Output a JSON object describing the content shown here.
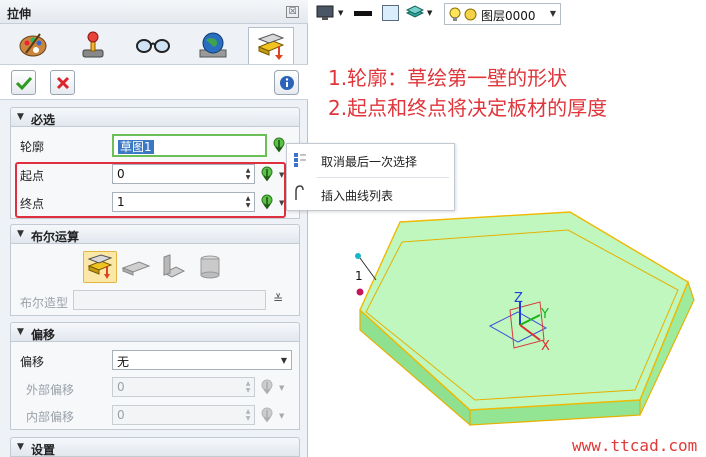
{
  "panel": {
    "title": "拉伸",
    "pin_glyph": "☒",
    "tabs": [
      {
        "name": "palette-icon"
      },
      {
        "name": "joystick-icon"
      },
      {
        "name": "glasses-icon"
      },
      {
        "name": "globe-icon"
      },
      {
        "name": "extrude-icon"
      }
    ],
    "actions": {
      "ok_icon": "checkmark-icon",
      "cancel_icon": "cross-icon",
      "info_icon": "info-icon"
    },
    "required": {
      "header": "必选",
      "profile_label": "轮廓",
      "profile_value": "草图1",
      "start_label": "起点",
      "start_value": "0",
      "end_label": "终点",
      "end_value": "1"
    },
    "boolean": {
      "header": "布尔运算",
      "shape_label": "布尔造型",
      "shape_value": ""
    },
    "offset": {
      "header": "偏移",
      "offset_label": "偏移",
      "offset_value": "无",
      "outer_label": "外部偏移",
      "outer_value": "0",
      "inner_label": "内部偏移",
      "inner_value": "0"
    },
    "settings": {
      "header": "设置"
    },
    "collapse_arrow": "▼"
  },
  "top_toolbar": {
    "layer_name": "图层0000"
  },
  "popup": {
    "item1": "取消最后一次选择",
    "item2": "插入曲线列表"
  },
  "annotation": {
    "line1": "1.轮廓：草绘第一壁的形状",
    "line2": "2.起点和终点将决定板材的厚度"
  },
  "viewport": {
    "sketch_marker": "1",
    "axis_x": "X",
    "axis_y": "Y",
    "axis_z": "Z",
    "solid_color": "#a6f2a6",
    "edge_color": "#f0b800"
  },
  "watermark": "www.ttcad.com",
  "colors": {
    "highlight_red": "#e03040",
    "profile_selection": "#3b78c4",
    "active_tab_yellow": "#fbe7a8"
  }
}
